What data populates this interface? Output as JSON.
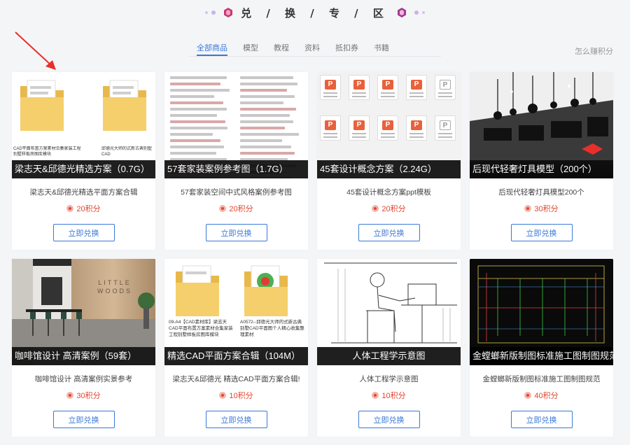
{
  "header": {
    "title": "兑 / 换 / 专 / 区",
    "earn_link": "怎么赚积分",
    "colors": {
      "accent": "#3b78d8",
      "price": "#e2452f",
      "hex_left": "#c83a72",
      "hex_right": "#a43a8e"
    }
  },
  "tabs": [
    {
      "label": "全部商品",
      "active": true
    },
    {
      "label": "模型",
      "active": false
    },
    {
      "label": "教程",
      "active": false
    },
    {
      "label": "资料",
      "active": false
    },
    {
      "label": "抵扣券",
      "active": false
    },
    {
      "label": "书籍",
      "active": false
    }
  ],
  "annotation": {
    "icon": "red-arrow-icon",
    "color": "#e8302a"
  },
  "cards": [
    {
      "thumb_type": "folder-pair",
      "caption": "梁志天&邱德光精选方案（0.7G）",
      "name": "梁志天&邱德光精选平面方案合辑",
      "price": "20积分",
      "button": "立即兑换",
      "file_labels": [
        "CAD平面布置方案素材合集家装工程别墅样板房图库模块",
        "邱德光大师的式新古典别墅CAD"
      ]
    },
    {
      "thumb_type": "text-list",
      "caption": "57套家装案例参考图（1.7G）",
      "name": "57套家装空间中式风格案例参考图",
      "price": "20积分",
      "button": "立即兑换"
    },
    {
      "thumb_type": "ppt-grid",
      "caption": "45套设计概念方案（2.24G）",
      "name": "45套设计概念方案ppt模板",
      "price": "20积分",
      "button": "立即兑换"
    },
    {
      "thumb_type": "lamp-render",
      "caption": "后现代轻奢灯具模型（200个）",
      "name": "后现代轻奢灯具模型200个",
      "price": "30积分",
      "button": "立即兑换"
    },
    {
      "thumb_type": "cafe-photo",
      "caption": "咖啡馆设计 高清案例（59套）",
      "name": "咖啡馆设计 高清案例实景参考",
      "price": "30积分",
      "button": "立即兑换",
      "sign_text": "LITTLE WOODS"
    },
    {
      "thumb_type": "folder-pair-2",
      "caption": "精选CAD平面方案合辑（104M）",
      "name": "梁志天&邱德光 精选CAD平面方案合辑!",
      "price": "10积分",
      "button": "立即兑换",
      "file_labels": [
        "09-A4【CAD素材库】梁志天CAD平面布置方案素材合集家装工程别墅样板房图库模块",
        "A0572--邱德光大师的式新古典别墅CAD平面图个人精心收集整理素材"
      ]
    },
    {
      "thumb_type": "sketch",
      "caption": "人体工程学示意图",
      "name": "人体工程学示意图",
      "price": "10积分",
      "button": "立即兑换"
    },
    {
      "thumb_type": "cad-drawing",
      "caption": "金螳螂新版制图标准施工图制图规范",
      "name": "金螳螂新版制图标准施工图制图规范",
      "price": "40积分",
      "button": "立即兑换"
    }
  ]
}
